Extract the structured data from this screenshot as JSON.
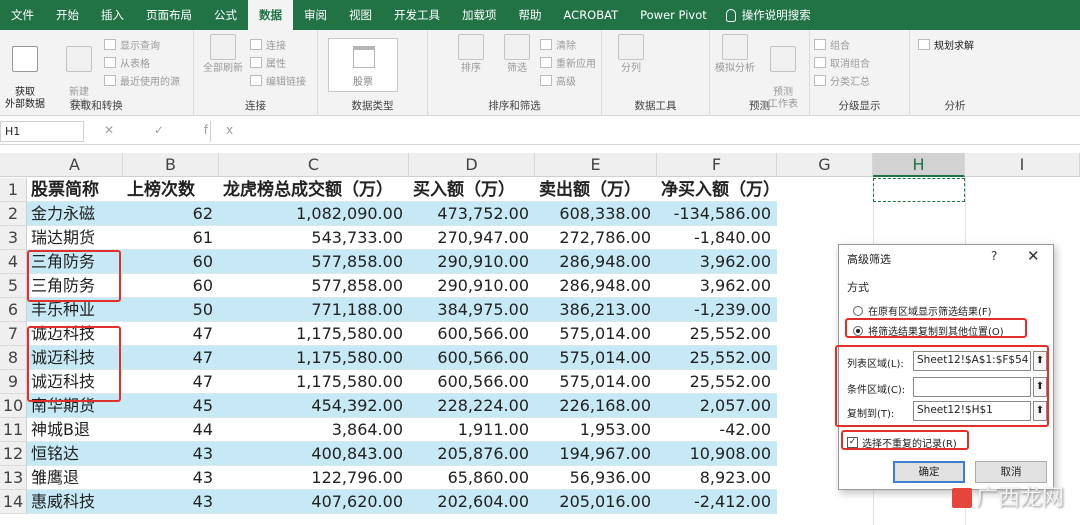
{
  "ribbon_tabs": [
    "文件",
    "开始",
    "插入",
    "页面布局",
    "公式",
    "数据",
    "审阅",
    "视图",
    "开发工具",
    "加载项",
    "帮助",
    "ACROBAT",
    "Power Pivot"
  ],
  "active_tab": "数据",
  "tell_me": "操作说明搜索",
  "ribbon": {
    "get_data": "获取\n外部数据",
    "new_query": "新建\n查询",
    "show_query": "显示查询",
    "from_table": "从表格",
    "recent_sources": "最近使用的源",
    "group_get_transform": "获取和转换",
    "refresh_all": "全部刷新",
    "connections": "连接",
    "properties": "属性",
    "edit_links": "编辑链接",
    "group_connections": "连接",
    "stocks": "股票",
    "group_data_types": "数据类型",
    "sort": "排序",
    "filter": "筛选",
    "clear": "清除",
    "reapply": "重新应用",
    "advanced": "高级",
    "group_sort_filter": "排序和筛选",
    "text_to_columns": "分列",
    "group_data_tools": "数据工具",
    "what_if": "模拟分析",
    "forecast_sheet": "预测\n工作表",
    "group_forecast": "预测",
    "group": "组合",
    "ungroup": "取消组合",
    "subtotal": "分类汇总",
    "group_outline": "分级显示",
    "solver": "规划求解",
    "group_analysis": "分析"
  },
  "name_box": "H1",
  "formula_icons": "✕ ✓ fx",
  "columns": [
    "A",
    "B",
    "C",
    "D",
    "E",
    "F",
    "G",
    "H",
    "I"
  ],
  "selected_column": "H",
  "row_numbers": [
    "1",
    "2",
    "3",
    "4",
    "5",
    "6",
    "7",
    "8",
    "9",
    "10",
    "11",
    "12",
    "13",
    "14"
  ],
  "table": {
    "headers": [
      "股票简称",
      "上榜次数",
      "龙虎榜总成交额（万）",
      "买入额（万）",
      "卖出额（万）",
      "净买入额（万）"
    ],
    "rows": [
      [
        "金力永磁",
        "62",
        "1,082,090.00",
        "473,752.00",
        "608,338.00",
        "-134,586.00"
      ],
      [
        "瑞达期货",
        "61",
        "543,733.00",
        "270,947.00",
        "272,786.00",
        "-1,840.00"
      ],
      [
        "三角防务",
        "60",
        "577,858.00",
        "290,910.00",
        "286,948.00",
        "3,962.00"
      ],
      [
        "三角防务",
        "60",
        "577,858.00",
        "290,910.00",
        "286,948.00",
        "3,962.00"
      ],
      [
        "丰乐种业",
        "50",
        "771,188.00",
        "384,975.00",
        "386,213.00",
        "-1,239.00"
      ],
      [
        "诚迈科技",
        "47",
        "1,175,580.00",
        "600,566.00",
        "575,014.00",
        "25,552.00"
      ],
      [
        "诚迈科技",
        "47",
        "1,175,580.00",
        "600,566.00",
        "575,014.00",
        "25,552.00"
      ],
      [
        "诚迈科技",
        "47",
        "1,175,580.00",
        "600,566.00",
        "575,014.00",
        "25,552.00"
      ],
      [
        "南华期货",
        "45",
        "454,392.00",
        "228,224.00",
        "226,168.00",
        "2,057.00"
      ],
      [
        "神城B退",
        "44",
        "3,864.00",
        "1,911.00",
        "1,953.00",
        "-42.00"
      ],
      [
        "恒铭达",
        "43",
        "400,843.00",
        "205,876.00",
        "194,967.00",
        "10,908.00"
      ],
      [
        "雏鹰退",
        "43",
        "122,796.00",
        "65,860.00",
        "56,936.00",
        "8,923.00"
      ],
      [
        "惠威科技",
        "43",
        "407,620.00",
        "202,604.00",
        "205,016.00",
        "-2,412.00"
      ]
    ]
  },
  "dialog": {
    "title": "高级筛选",
    "help": "?",
    "close": "✕",
    "mode_label": "方式",
    "option_inplace": "在原有区域显示筛选结果(F)",
    "option_copy": "将筛选结果复制到其他位置(O)",
    "list_range_label": "列表区域(L):",
    "list_range_value": "Sheet12!$A$1:$F$54",
    "criteria_range_label": "条件区域(C):",
    "criteria_range_value": "",
    "copy_to_label": "复制到(T):",
    "copy_to_value": "Sheet12!$H$1",
    "unique_label": "选择不重复的记录(R)",
    "unique_checked": true,
    "ok": "确定",
    "cancel": "取消"
  },
  "watermark": "广西龙网",
  "colors": {
    "excel_green": "#217346",
    "band_blue": "#c6e9f5",
    "highlight_red": "#e0302b"
  }
}
